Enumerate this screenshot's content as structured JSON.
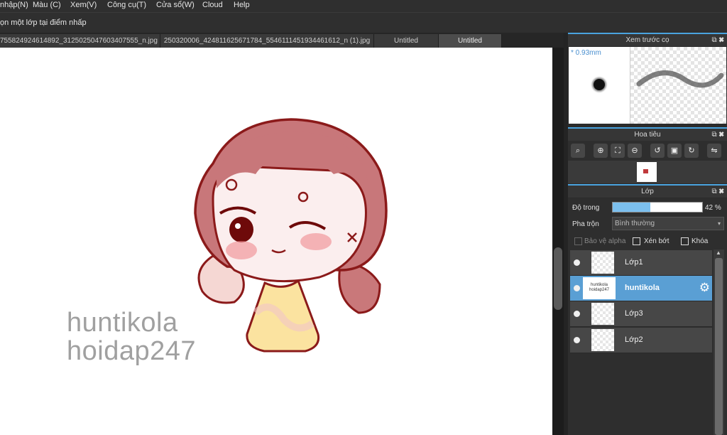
{
  "menu": [
    "nhập(N)",
    "Màu (C)",
    "Xem(V)",
    "Công cụ(T)",
    "Cửa sổ(W)",
    "Cloud",
    "Help"
  ],
  "hint": "ọn một lớp tại điểm nhấp",
  "tabs": [
    "755824924614892_3125025047603407555_n.jpg",
    "250320006_424811625671784_5546111451934461612_n (1).jpg",
    "Untitled",
    "Untitled"
  ],
  "watermark": [
    "huntikola",
    "hoidap247"
  ],
  "brush_panel": {
    "title": "Xem trước cọ",
    "size": "* 0.93mm"
  },
  "navigator": {
    "title": "Hoa tiêu"
  },
  "layers_panel": {
    "title": "Lớp",
    "opacity_label": "Độ trong",
    "opacity_value": "42 %",
    "opacity_fraction": 0.42,
    "blend_label": "Pha trộn",
    "blend_value": "Bình thường",
    "protect_alpha": "Bảo vệ alpha",
    "clipping": "Xén bớt",
    "lock": "Khóa",
    "layers": [
      {
        "name": "Lớp1",
        "selected": false
      },
      {
        "name": "huntikola",
        "selected": true,
        "thumb_text": "huntikola hoidap247"
      },
      {
        "name": "Lớp3",
        "selected": false
      },
      {
        "name": "Lớp2",
        "selected": false
      }
    ]
  },
  "colors": {
    "accent": "#4aa3df",
    "selected_layer": "#5a9fd4",
    "stroke": "#8b1a1a"
  }
}
